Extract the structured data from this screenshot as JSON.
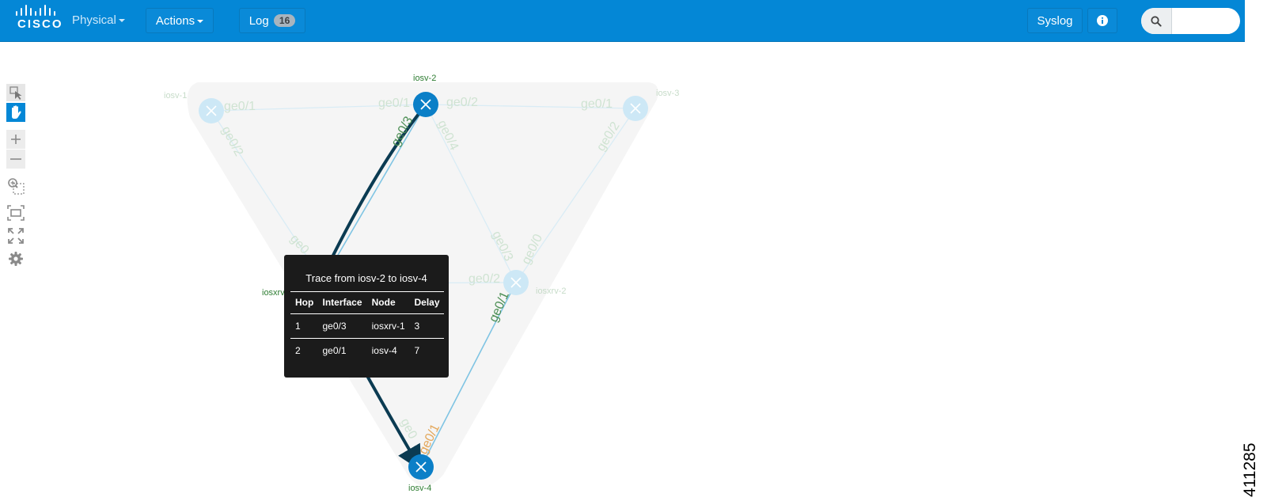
{
  "brand": {
    "logo_text": "CISCO"
  },
  "topbar": {
    "view_label": "Physical",
    "actions_label": "Actions",
    "log_label": "Log",
    "log_count": "16",
    "syslog_label": "Syslog",
    "search_placeholder": ""
  },
  "toolbar": {
    "tools": [
      "select-icon",
      "pan-hand-icon",
      "zoom-in-icon",
      "zoom-out-icon",
      "zoom-selection-icon",
      "fit-view-icon",
      "expand-icon",
      "settings-gear-icon"
    ],
    "zoom_in_label": "+",
    "zoom_out_label": "—"
  },
  "topology": {
    "nodes": {
      "iosv_1": "iosv-1",
      "iosv_2": "iosv-2",
      "iosv_3": "iosv-3",
      "iosv_4": "iosv-4",
      "iosxrv_1": "iosxrv",
      "iosxrv_2": "iosxrv-2"
    },
    "interfaces": {
      "iosv1_a": "ge0/1",
      "iosv1_b": "ge0/2",
      "iosv2_a": "ge0/1",
      "iosv2_b": "ge0/2",
      "iosv2_c": "ge0/3",
      "iosv2_d": "ge0/4",
      "iosv3_a": "ge0/1",
      "iosv3_b": "ge0/2",
      "xrv2_a": "ge0/3",
      "xrv2_b": "ge0/0",
      "xrv2_c": "ge0/2",
      "xrv2_d": "ge0/1",
      "xrv1_a": "ge0",
      "iosv4_a": "ge0/1",
      "iosv4_b": "ge0"
    },
    "colors": {
      "active_node": "#0b7fc7",
      "faded_node": "#cde8f6",
      "trace_path": "#0b3b52",
      "link": "#7fc4e3",
      "label_green": "#2e7d32"
    }
  },
  "trace": {
    "title": "Trace from iosv-2 to iosv-4",
    "headers": [
      "Hop",
      "Interface",
      "Node",
      "Delay"
    ],
    "rows": [
      {
        "hop": "1",
        "interface": "ge0/3",
        "node": "iosxrv-1",
        "delay": "3"
      },
      {
        "hop": "2",
        "interface": "ge0/1",
        "node": "iosv-4",
        "delay": "7"
      }
    ]
  },
  "figure_id": "411285"
}
